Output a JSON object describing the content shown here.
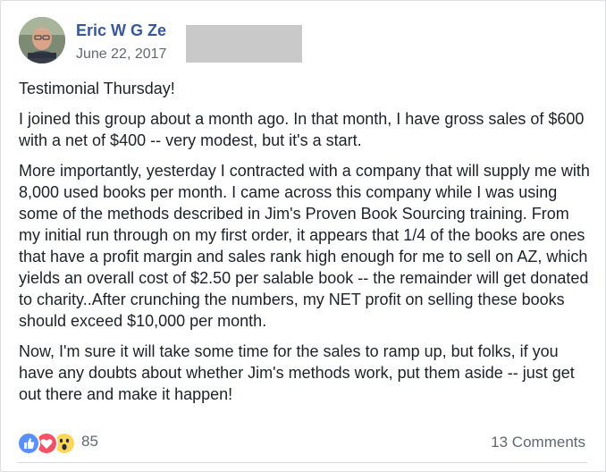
{
  "post": {
    "author_name": "Eric W G Ze",
    "date": "June 22, 2017",
    "paragraphs": [
      "Testimonial Thursday!",
      "I joined this group about a month ago. In that month, I have gross sales of $600 with a net of $400 -- very modest, but it's a start.",
      "More importantly, yesterday I contracted with a company that will supply me with 8,000 used books per month. I came across this company while I was using some of the methods described in Jim's Proven Book Sourcing training. From my initial run through on my first order, it appears that 1/4 of the books are ones that have a profit margin and sales rank high enough for me to sell on AZ, which yields an overall cost of $2.50 per salable book -- the remainder will get donated to charity..After crunching the numbers, my NET profit on selling these books should exceed $10,000 per month.",
      "Now, I'm sure it will take some time for the sales to ramp up, but folks, if you have any doubts about whether Jim's methods work, put them aside -- just get out there and make it happen!"
    ]
  },
  "footer": {
    "reaction_icons": [
      "like-icon",
      "love-icon",
      "wow-icon"
    ],
    "reaction_count": "85",
    "comments_label": "13 Comments"
  },
  "colors": {
    "author_link": "#365899",
    "meta_text": "#616770",
    "body_text": "#1d2129",
    "like": "#5890ff",
    "love": "#f25268",
    "wow": "#fcd75c",
    "redaction": "#c9c9c9"
  }
}
